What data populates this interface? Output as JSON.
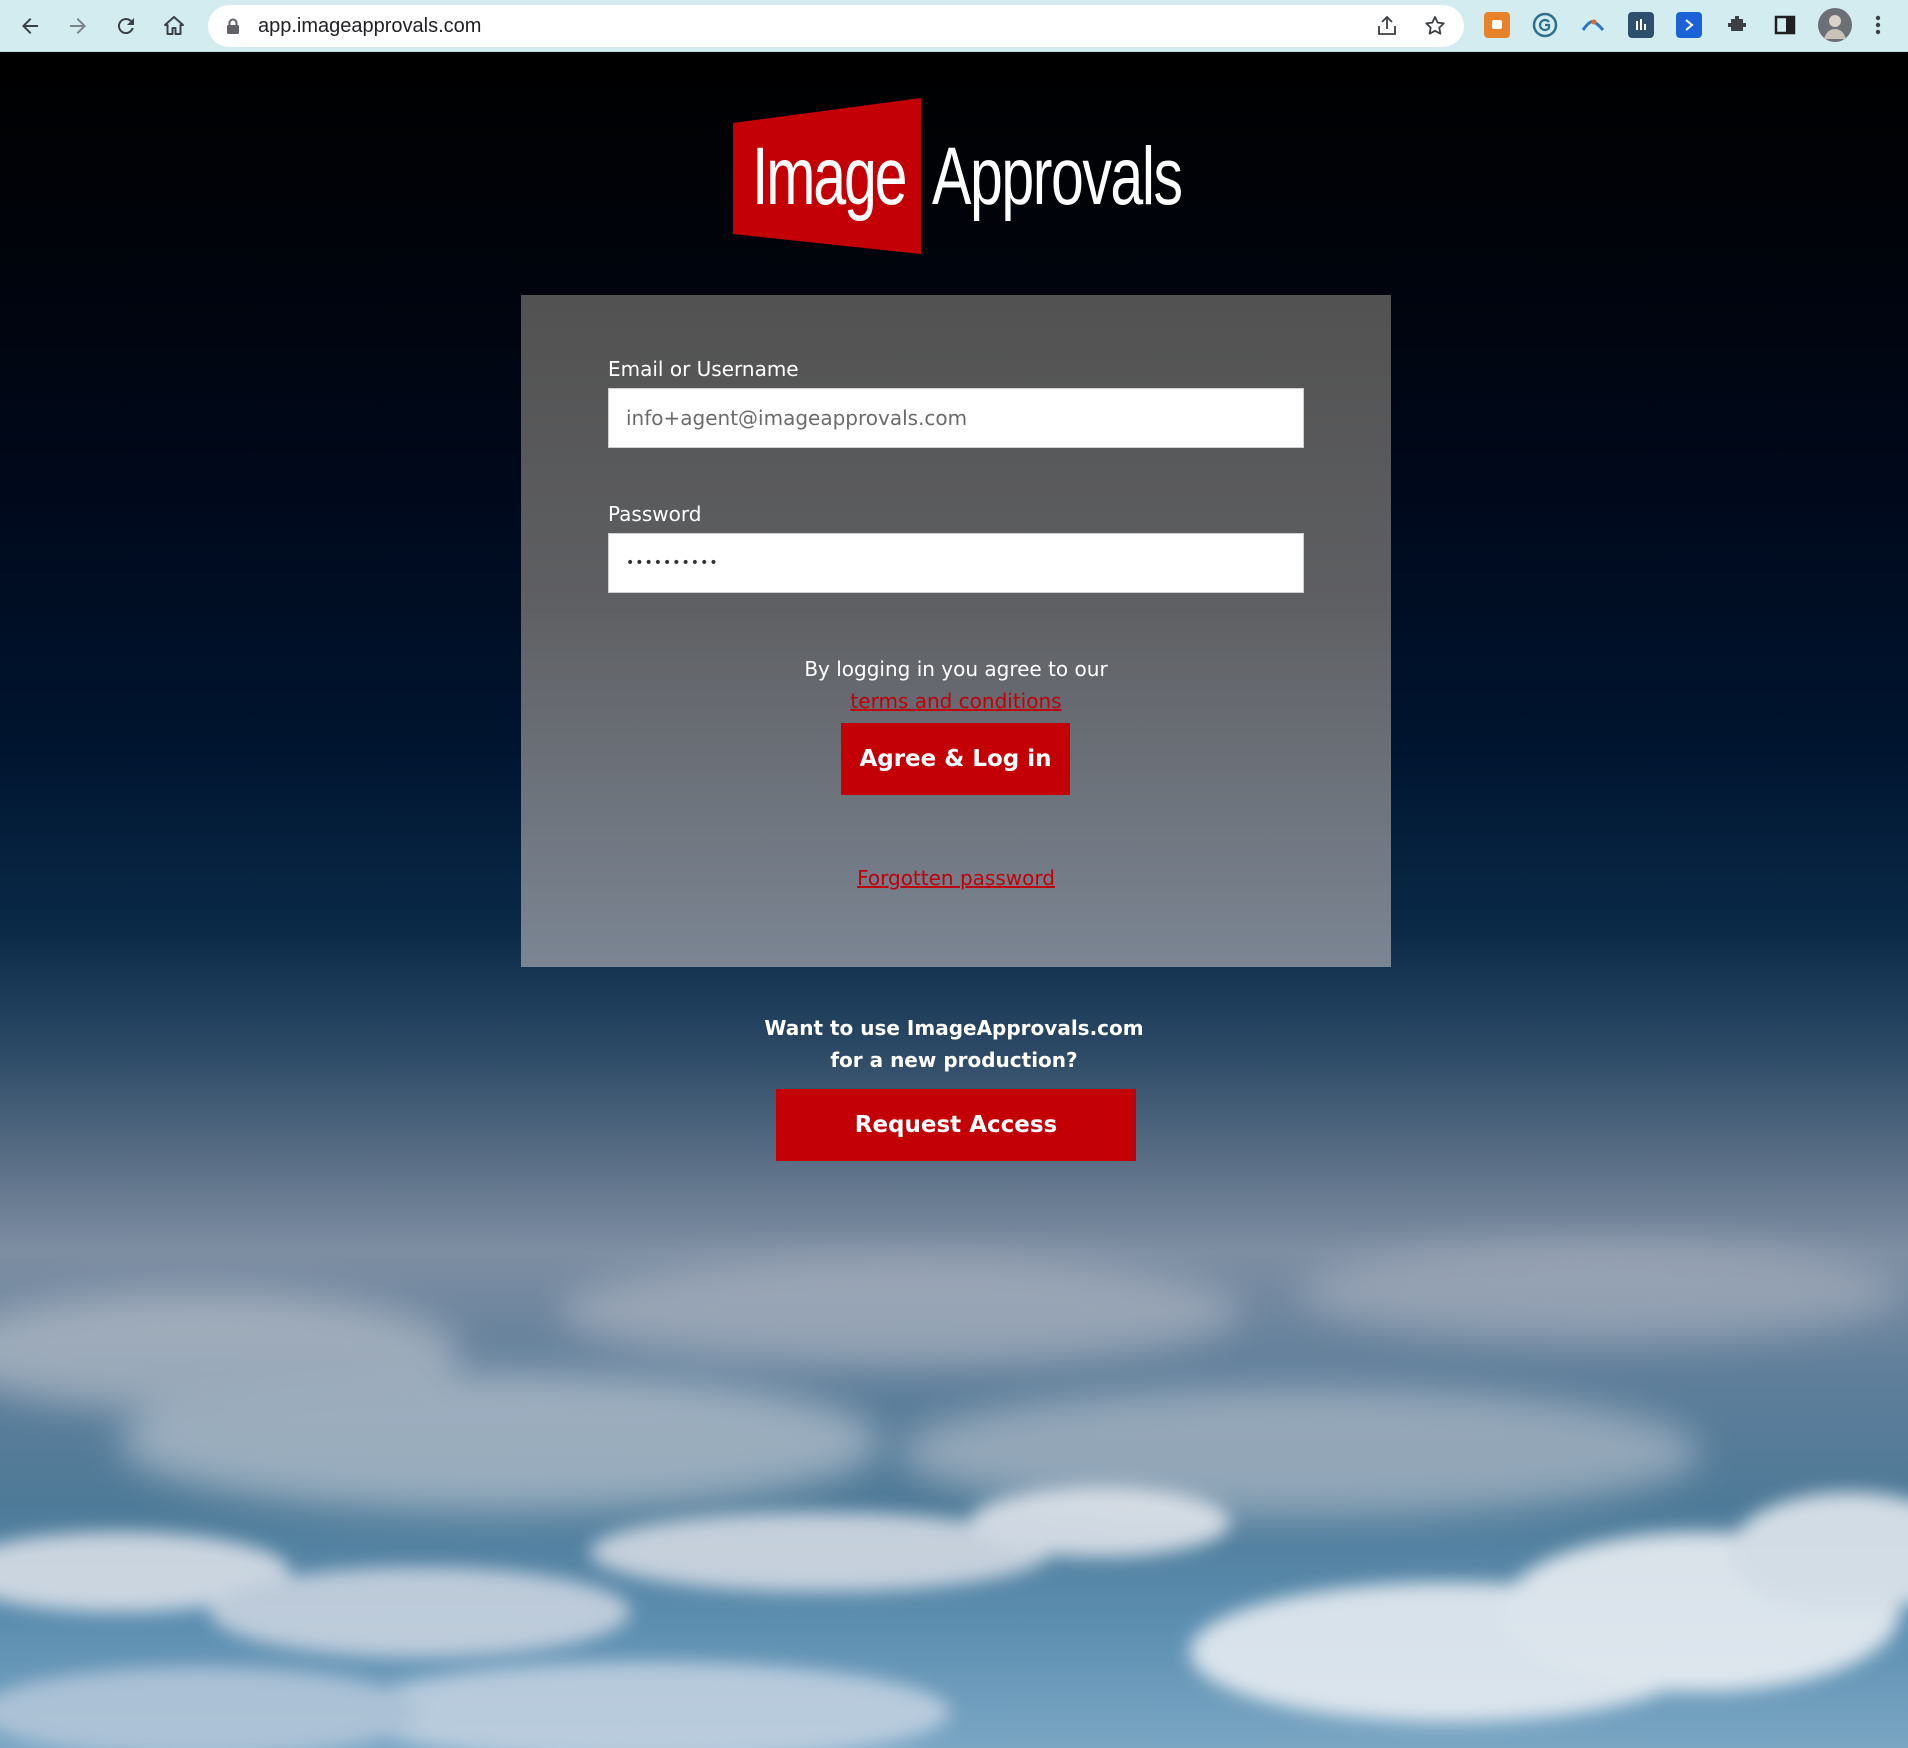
{
  "browser": {
    "url": "app.imageapprovals.com",
    "extensions": [
      {
        "name": "orange-extension-icon",
        "color": "#e8822a"
      },
      {
        "name": "grammarly-extension-icon",
        "color": "#15c39a"
      },
      {
        "name": "arc-extension-icon",
        "color": "#e66b2a"
      },
      {
        "name": "analytics-extension-icon",
        "color": "#2f5f8a"
      },
      {
        "name": "blue-arrow-extension-icon",
        "color": "#1a63d6"
      }
    ]
  },
  "logo": {
    "word1": "Image",
    "word2": "Approvals",
    "red_color": "#c20006"
  },
  "login": {
    "email_label": "Email or Username",
    "email_value": "info+agent@imageapprovals.com",
    "password_label": "Password",
    "password_value": "••••••••••",
    "agree_text": "By logging in you agree to our",
    "terms_link": "terms and conditions",
    "login_button": "Agree & Log in",
    "forgot_link": "Forgotten password"
  },
  "promo": {
    "line1": "Want to use ImageApprovals.com",
    "line2": "for a new production?",
    "button": "Request Access"
  }
}
